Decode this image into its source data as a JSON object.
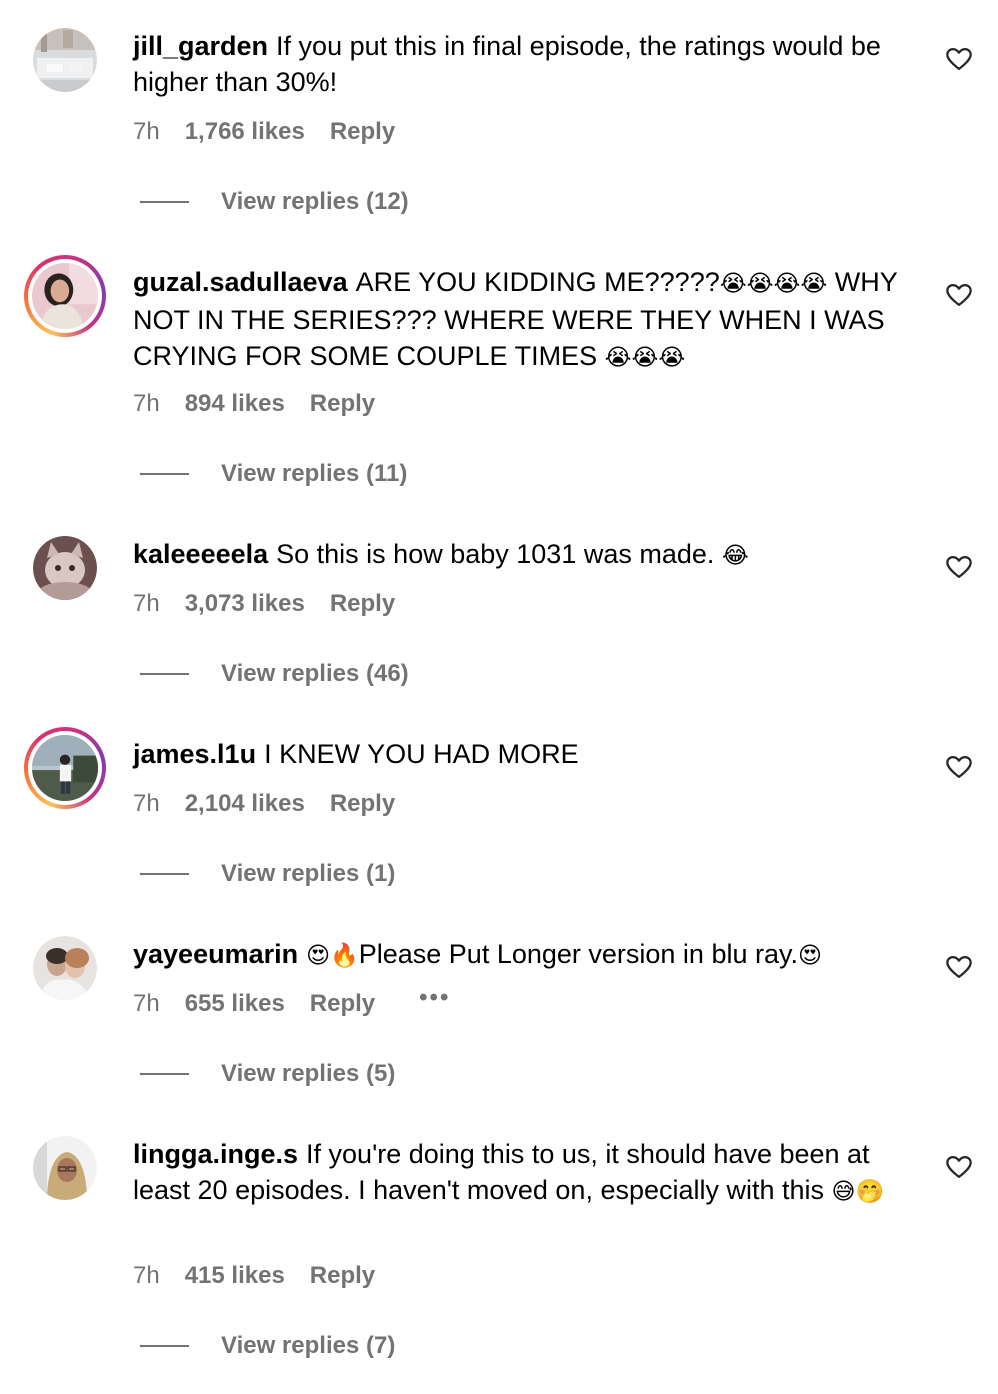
{
  "comments": [
    {
      "username": "jill_garden",
      "text": "If you put this in final episode, the ratings would be higher than 30%!",
      "emoji": "",
      "time": "7h",
      "likes": "1,766 likes",
      "reply_label": "Reply",
      "view_replies": "View replies (12)",
      "avatar_icon": "avatar-photo-white-room",
      "has_story_ring": false
    },
    {
      "username": "guzal.sadullaeva",
      "text": "ARE YOU KIDDING ME?????",
      "emoji": "😭😭😭😭",
      "text_after": " WHY NOT IN THE SERIES??? WHERE WERE THEY WHEN I WAS CRYING FOR SOME COUPLE TIMES ",
      "emoji_after": "😭😭😭",
      "time": "7h",
      "likes": "894 likes",
      "reply_label": "Reply",
      "view_replies": "View replies (11)",
      "avatar_icon": "avatar-photo-woman",
      "has_story_ring": true
    },
    {
      "username": "kaleeeeela",
      "text": "So this is how baby 1031 was made. ",
      "emoji": "😂",
      "time": "7h",
      "likes": "3,073 likes",
      "reply_label": "Reply",
      "view_replies": "View replies (46)",
      "avatar_icon": "avatar-photo-cat",
      "has_story_ring": false
    },
    {
      "username": "james.l1u",
      "text": "I KNEW YOU HAD MORE",
      "emoji": "",
      "time": "7h",
      "likes": "2,104 likes",
      "reply_label": "Reply",
      "view_replies": "View replies (1)",
      "avatar_icon": "avatar-photo-person-outdoors",
      "has_story_ring": true
    },
    {
      "username": "yayeeumarin",
      "emoji_before": "😍🔥",
      "text": "Please Put Longer version in blu ray.",
      "emoji": "😍",
      "time": "7h",
      "likes": "655 likes",
      "reply_label": "Reply",
      "more_label": "•••",
      "view_replies": "View replies (5)",
      "avatar_icon": "avatar-photo-couple",
      "has_story_ring": false
    },
    {
      "username": "lingga.inge.s",
      "text": "If you're doing this to us, it should have been at least 20 episodes. I haven't moved on, especially with this ",
      "emoji": "😅🤭",
      "time": "7h",
      "likes": "415 likes",
      "reply_label": "Reply",
      "view_replies": "View replies (7)",
      "avatar_icon": "avatar-photo-hijab",
      "has_story_ring": false
    }
  ],
  "colors": {
    "secondary_text": "#737373",
    "primary_text": "#000000",
    "story_ring": [
      "#fdc15a",
      "#e1306c",
      "#833ab4"
    ]
  },
  "icons": {
    "like": "heart-outline-icon"
  }
}
